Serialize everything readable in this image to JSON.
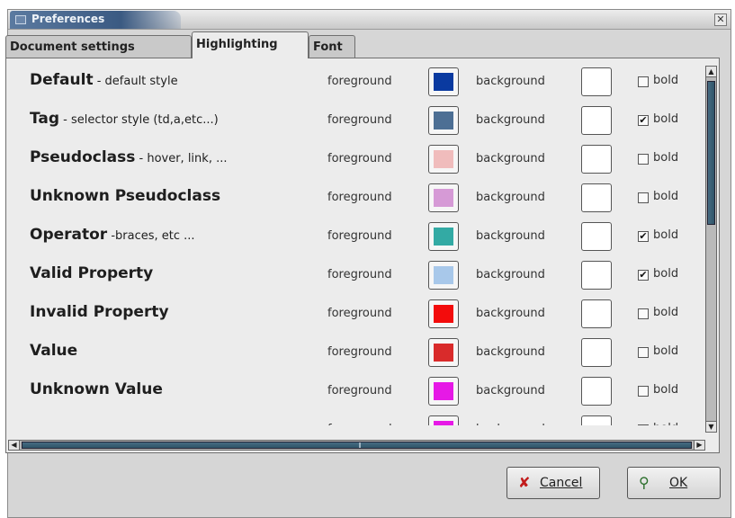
{
  "window": {
    "title": "Preferences",
    "close_glyph": "✕"
  },
  "tabs": [
    {
      "label": "Document settings",
      "active": false
    },
    {
      "label": "Highlighting",
      "active": true
    },
    {
      "label": "Font",
      "active": false
    }
  ],
  "highlighting": {
    "foreground_label": "foreground",
    "background_label": "background",
    "bold_label": "bold",
    "styles": [
      {
        "name": "Default",
        "desc": " - default style",
        "fg": "#0a3aa0",
        "bg": "#ffffff",
        "bold": false
      },
      {
        "name": "Tag",
        "desc": " - selector style (td,a,etc...)",
        "fg": "#4d6f94",
        "bg": "#ffffff",
        "bold": true
      },
      {
        "name": "Pseudoclass",
        "desc": " - hover, link, ...",
        "fg": "#f0bcbc",
        "bg": "#ffffff",
        "bold": false
      },
      {
        "name": "Unknown Pseudoclass",
        "desc": "",
        "fg": "#d69ad6",
        "bg": "#ffffff",
        "bold": false
      },
      {
        "name": "Operator",
        "desc": " -braces, etc ...",
        "fg": "#33aaa4",
        "bg": "#ffffff",
        "bold": true
      },
      {
        "name": "Valid Property",
        "desc": "",
        "fg": "#a8c8ea",
        "bg": "#ffffff",
        "bold": true
      },
      {
        "name": "Invalid Property",
        "desc": "",
        "fg": "#f30c0c",
        "bg": "#ffffff",
        "bold": false
      },
      {
        "name": "Value",
        "desc": "",
        "fg": "#d92b2b",
        "bg": "#ffffff",
        "bold": false
      },
      {
        "name": "Unknown Value",
        "desc": "",
        "fg": "#e619e6",
        "bg": "#ffffff",
        "bold": false
      },
      {
        "name": "-",
        "desc": "",
        "fg": "#e619e6",
        "bg": "#ffffff",
        "bold": false
      }
    ]
  },
  "buttons": {
    "cancel_label": "Cancel",
    "ok_label": "OK",
    "cancel_icon": "✘",
    "ok_icon": "⚲"
  }
}
